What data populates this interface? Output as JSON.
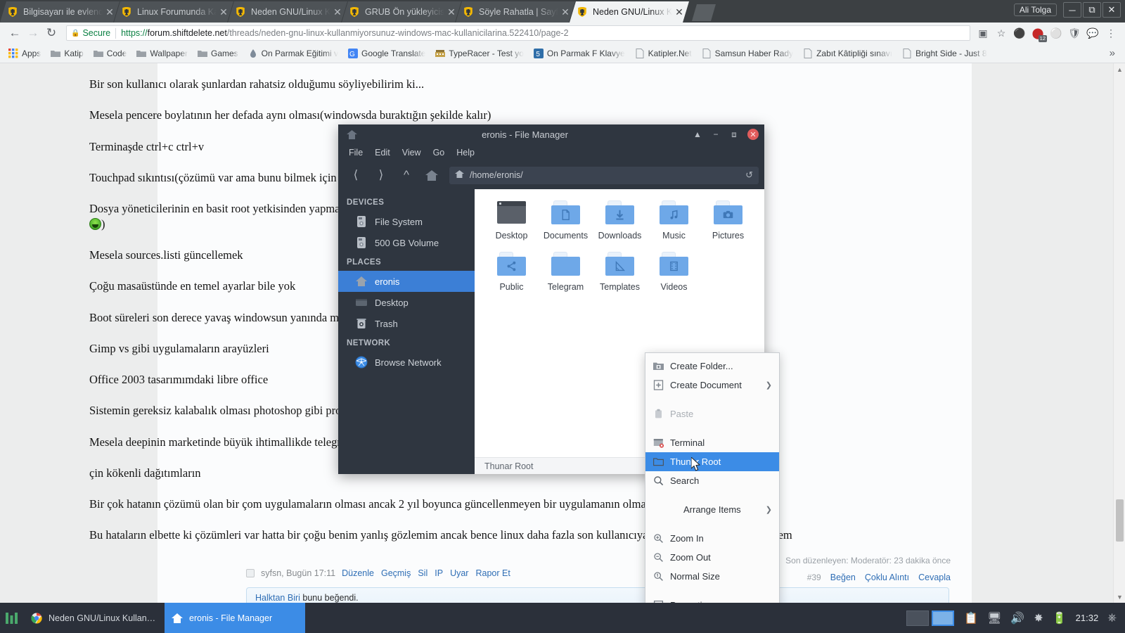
{
  "browser": {
    "user_label": "Ali Tolga",
    "window_buttons": [
      "minimize",
      "maximize",
      "close"
    ],
    "tabs": [
      {
        "title": "Bilgisayarı ile evlendi, ş",
        "favicon": "shiftdelete-favicon",
        "active": false
      },
      {
        "title": "Linux Forumunda Kali L",
        "favicon": "shiftdelete-favicon",
        "active": false
      },
      {
        "title": "Neden GNU/Linux Kull",
        "favicon": "shiftdelete-favicon",
        "active": false
      },
      {
        "title": "GRUB Ön yükleyicisi W",
        "favicon": "shiftdelete-favicon",
        "active": false
      },
      {
        "title": "Söyle Rahatla | Sayfa 7",
        "favicon": "shiftdelete-favicon",
        "active": false
      },
      {
        "title": "Neden GNU/Linux Kull",
        "favicon": "shiftdelete-favicon",
        "active": true
      }
    ],
    "omnibox": {
      "secure_label": "Secure",
      "url_scheme": "https://",
      "url_host": "forum.shiftdelete.net",
      "url_path": "/threads/neden-gnu-linux-kullanmiyorsunuz-windows-mac-kullanicilarina.522410/page-2",
      "full_url": "https://forum.shiftdelete.net/threads/neden-gnu-linux-kullanmiyorsunuz-windows-mac-kullanicilarina.522410/page-2",
      "translate_icon": "translate-icon",
      "bookmark_icon": "star-icon",
      "extension_badge_count": "12",
      "menu_icon": "three-dot-menu-icon"
    },
    "bookmarks": [
      {
        "label": "Apps",
        "icon": "apps-grid-icon"
      },
      {
        "label": "Katip",
        "icon": "folder-icon"
      },
      {
        "label": "Code",
        "icon": "folder-icon"
      },
      {
        "label": "Wallpaper",
        "icon": "folder-icon"
      },
      {
        "label": "Games",
        "icon": "folder-icon"
      },
      {
        "label": "On Parmak Eğitimi v",
        "icon": "water-drop-icon"
      },
      {
        "label": "Google Translate",
        "icon": "google-translate-icon"
      },
      {
        "label": "TypeRacer - Test yo",
        "icon": "typeracer-icon"
      },
      {
        "label": "On Parmak F Klavye",
        "icon": "number-5-icon"
      },
      {
        "label": "Katipler.Net",
        "icon": "page-icon"
      },
      {
        "label": "Samsun Haber Rady",
        "icon": "page-icon"
      },
      {
        "label": "Zabıt Kâtipliği sınavı",
        "icon": "page-icon"
      },
      {
        "label": "Bright Side - Just 8",
        "icon": "page-icon"
      }
    ],
    "bookmarks_overflow": "»"
  },
  "page": {
    "paragraphs": [
      "Bir son kullanıcı olarak şunlardan rahatsiz olduğumu söyliyebilirim ki...",
      "Mesela pencere boylatının her defada aynı olması(windowsda buraktığın şekilde kalır)",
      "Terminaşde ctrl+c ctrl+v",
      "Touchpad sıkıntısı(çözümü var ama bunu bilmek için yine terminal)",
      "Dosya yöneticilerinin en basit root yetkisinden yapmak için yine terminal gerekli",
      "Mesela sources.listi güncellemek",
      "Çoğu masaüstünde en temel ayarlar bile yok",
      "Boot süreleri son derece yavaş windowsun yanında minimal.",
      "Gimp vs gibi uygulamaların arayüzleri",
      "Office 2003 tasarımımdaki libre office",
      "Sistemin gereksiz kalabalık olması photoshop gibi programları bir çok kişi kullanmıyor (bunun yerine)",
      "Mesela deepinin marketinde büyük ihtimallikde telegram whatsapp gibi uygulamaların bulunmaması",
      "çin kökenli dağıtımların",
      "Bir çok hatanın çözümü olan bir çom uygulamaların olması ancak 2 yıl boyunca güncellenmeyen bir uygulamanın olmaaı(debian dışında)",
      "Bu hataların elbette ki çözümleri var hatta bir çoğu benim yanlış gözlemim ancak bence linux daha fazla son kullanıcıya pratiklik sağlayacak bir sistem"
    ],
    "post_meta": {
      "author_time": "syfsn, Bugün 17:11",
      "links": [
        "Düzenle",
        "Geçmiş",
        "Sil",
        "IP",
        "Uyar",
        "Rapor Et"
      ]
    },
    "moderator_note": "Son düzenleyen: Moderatör: 23 dakika önce",
    "post_number": "#39",
    "post_actions": [
      "Beğen",
      "Çoklu Alıntı",
      "Cevapla"
    ],
    "like_bar": {
      "user": "Halktan Biri",
      "text": " bunu beğendi."
    }
  },
  "thunar": {
    "title": "eronis - File Manager",
    "titlebar_icons": [
      "home-icon",
      "eject-icon",
      "minimize-icon",
      "maximize-icon",
      "close-icon"
    ],
    "menus": [
      "File",
      "Edit",
      "View",
      "Go",
      "Help"
    ],
    "toolbar": {
      "back_icon": "back-arrow-icon",
      "forward_icon": "forward-arrow-icon",
      "up_icon": "up-arrow-icon",
      "home_icon": "home-icon",
      "path": "/home/eronis/",
      "reload_icon": "reload-icon"
    },
    "sidebar": [
      {
        "type": "header",
        "label": "DEVICES"
      },
      {
        "type": "item",
        "label": "File System",
        "icon": "drive-icon",
        "selected": false
      },
      {
        "type": "item",
        "label": "500 GB Volume",
        "icon": "drive-icon",
        "selected": false
      },
      {
        "type": "header",
        "label": "PLACES"
      },
      {
        "type": "item",
        "label": "eronis",
        "icon": "home-icon",
        "selected": true
      },
      {
        "type": "item",
        "label": "Desktop",
        "icon": "desktop-icon",
        "selected": false
      },
      {
        "type": "item",
        "label": "Trash",
        "icon": "trash-icon",
        "selected": false
      },
      {
        "type": "header",
        "label": "NETWORK"
      },
      {
        "type": "item",
        "label": "Browse Network",
        "icon": "network-globe-icon",
        "selected": false
      }
    ],
    "files": [
      {
        "label": "Desktop",
        "icon": "desktop-window-icon"
      },
      {
        "label": "Documents",
        "icon": "folder-document-icon"
      },
      {
        "label": "Downloads",
        "icon": "folder-download-icon"
      },
      {
        "label": "Music",
        "icon": "folder-music-icon"
      },
      {
        "label": "Pictures",
        "icon": "folder-camera-icon"
      },
      {
        "label": "Public",
        "icon": "folder-share-icon"
      },
      {
        "label": "Telegram",
        "icon": "folder-plain-icon"
      },
      {
        "label": "Templates",
        "icon": "folder-template-icon"
      },
      {
        "label": "Videos",
        "icon": "folder-video-icon"
      }
    ],
    "statusbar": "Thunar Root"
  },
  "context_menu": {
    "items": [
      {
        "label": "Create Folder...",
        "icon": "new-folder-icon",
        "state": "normal",
        "submenu": false
      },
      {
        "label": "Create Document",
        "icon": "new-document-icon",
        "state": "normal",
        "submenu": true
      },
      {
        "type": "gap"
      },
      {
        "label": "Paste",
        "icon": "paste-icon",
        "state": "disabled",
        "submenu": false
      },
      {
        "type": "gap"
      },
      {
        "label": "Terminal",
        "icon": "terminal-icon",
        "state": "normal",
        "submenu": false
      },
      {
        "label": "Thunar Root",
        "icon": "folder-icon",
        "state": "selected",
        "submenu": false
      },
      {
        "label": "Search",
        "icon": "search-icon",
        "state": "normal",
        "submenu": false
      },
      {
        "type": "gap"
      },
      {
        "label": "Arrange Items",
        "icon": "none",
        "state": "normal",
        "submenu": true
      },
      {
        "type": "gap"
      },
      {
        "label": "Zoom In",
        "icon": "zoom-in-icon",
        "state": "normal",
        "submenu": false
      },
      {
        "label": "Zoom Out",
        "icon": "zoom-out-icon",
        "state": "normal",
        "submenu": false
      },
      {
        "label": "Normal Size",
        "icon": "zoom-reset-icon",
        "state": "normal",
        "submenu": false
      },
      {
        "type": "gap"
      },
      {
        "label": "Properties...",
        "icon": "properties-icon",
        "state": "normal",
        "submenu": false
      }
    ]
  },
  "taskbar": {
    "launcher_icon": "whisker-menu-icon",
    "tasks": [
      {
        "label": "Neden GNU/Linux Kullanmı...",
        "icon": "chrome-icon",
        "active": false
      },
      {
        "label": "eronis - File Manager",
        "icon": "home-icon",
        "active": true
      }
    ],
    "workspaces": [
      {
        "active": false
      },
      {
        "active": true
      }
    ],
    "tray_icons": [
      "clipboard-icon",
      "display-icon",
      "volume-icon",
      "updates-icon",
      "battery-icon"
    ],
    "clock": "21:32",
    "power_icon": "power-icon"
  },
  "colors": {
    "chrome_tabstrip": "#3c4043",
    "accent_blue": "#3c8ce6",
    "thunar_dark": "#2f3640",
    "folder_blue": "#6ea8e8",
    "secure_green": "#0b8043",
    "link_blue": "#2f6eb5",
    "close_red": "#e05c5c"
  }
}
